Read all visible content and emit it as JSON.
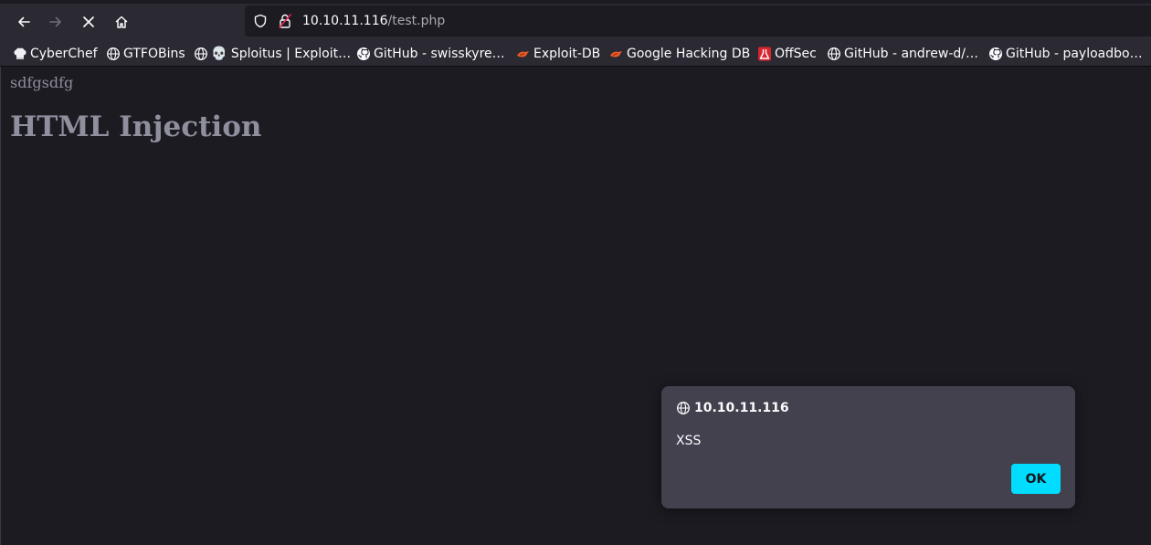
{
  "browser": {
    "url_host": "10.10.11.116",
    "url_path": "/test.php"
  },
  "bookmarks": [
    {
      "label": "CyberChef",
      "icon": "chef-hat-icon"
    },
    {
      "label": "GTFOBins",
      "icon": "globe-icon"
    },
    {
      "label": "💀 Sploitus | Exploit…",
      "icon": "globe-icon"
    },
    {
      "label": "GitHub - swisskyre…",
      "icon": "github-icon"
    },
    {
      "label": "Exploit-DB",
      "icon": "exploit-db-icon"
    },
    {
      "label": "Google Hacking DB",
      "icon": "exploit-db-icon"
    },
    {
      "label": "OffSec",
      "icon": "offsec-icon"
    },
    {
      "label": "GitHub - andrew-d/…",
      "icon": "globe-icon"
    },
    {
      "label": "GitHub - payloadbo…",
      "icon": "github-icon"
    }
  ],
  "page": {
    "text": "sdfgsdfg",
    "heading": "HTML Injection"
  },
  "alert": {
    "origin": "10.10.11.116",
    "message": "XSS",
    "ok_label": "OK"
  },
  "colors": {
    "accent": "#00ddff",
    "toolbar": "#2b2a33",
    "content": "#1c1b22",
    "dialog": "#42414d"
  }
}
